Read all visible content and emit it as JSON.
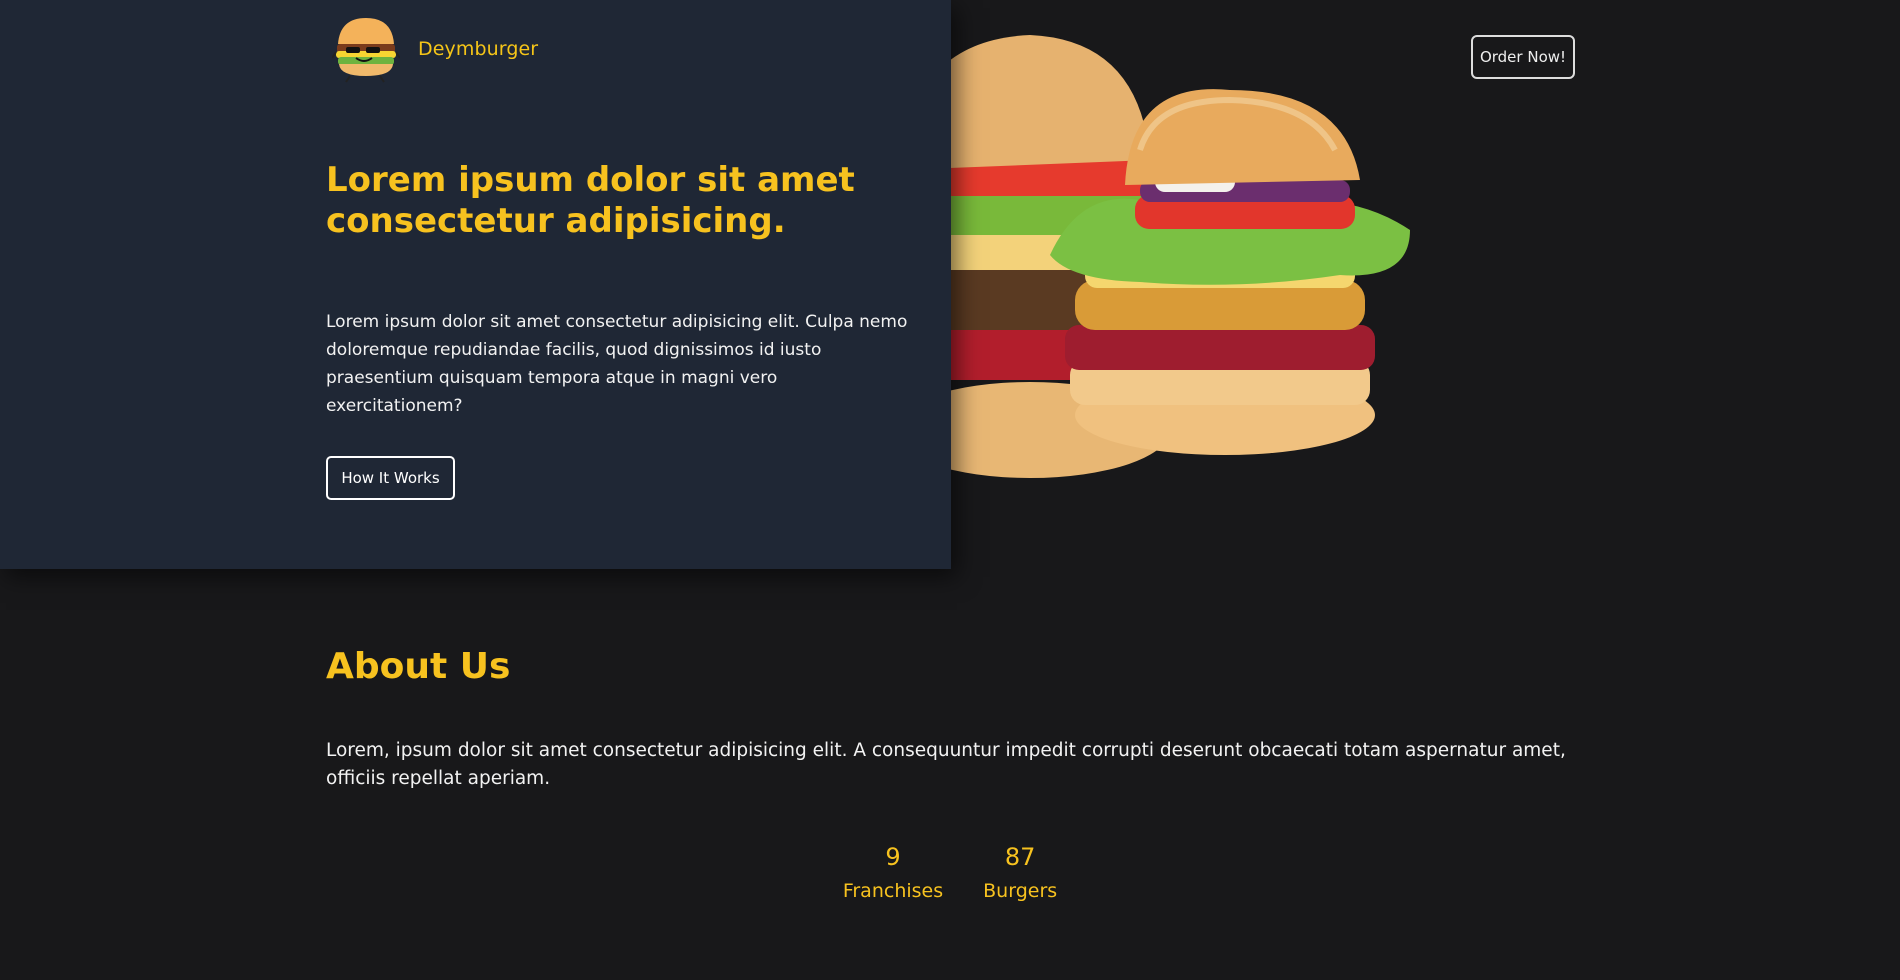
{
  "brand": {
    "name": "Deymburger",
    "logo_icon": "burger-mascot-icon"
  },
  "header": {
    "order_button": "Order Now!"
  },
  "hero": {
    "title": "Lorem ipsum dolor sit amet consectetur adipisicing.",
    "text": "Lorem ipsum dolor sit amet consectetur adipisicing elit. Culpa nemo doloremque repudiandae facilis, quod dignissimos id iusto praesentium quisquam tempora atque in magni vero exercitationem?",
    "button": "How It Works",
    "image_icon": "burgers-image"
  },
  "about": {
    "title": "About Us",
    "text": "Lorem, ipsum dolor sit amet consectetur adipisicing elit. A consequuntur impedit corrupti deserunt obcaecati totam aspernatur amet, officiis repellat aperiam."
  },
  "stats": [
    {
      "value": "9",
      "label": "Franchises"
    },
    {
      "value": "87",
      "label": "Burgers"
    }
  ],
  "colors": {
    "accent": "#f7c21f",
    "panel": "#1f2735",
    "background": "#18181a"
  }
}
